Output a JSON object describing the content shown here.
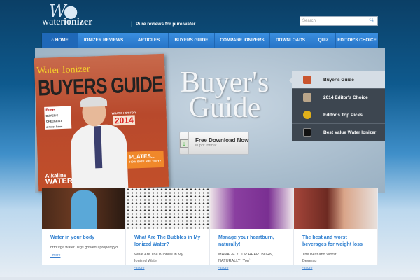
{
  "header": {
    "logo_mark": "W",
    "logo_text_light": "water",
    "logo_text_bold": "ionizer",
    "separator": "|",
    "tagline": "Pure reviews for pure water",
    "search_placeholder": "Search",
    "search_icon": "magnifier-icon"
  },
  "nav": [
    {
      "label": "HOME",
      "icon": "home-icon",
      "active": true
    },
    {
      "label": "IONIZER REVIEWS"
    },
    {
      "label": "ARTICLES"
    },
    {
      "label": "BUYERS GUIDE"
    },
    {
      "label": "COMPARE IONIZERS"
    },
    {
      "label": "DOWNLOADS"
    },
    {
      "label": "QUIZ"
    },
    {
      "label": "EDITOR'S CHOICE"
    }
  ],
  "hero": {
    "cover": {
      "title1": "Water Ionizer",
      "title2": "BUYERS GUIDE",
      "free": "Free",
      "checklist": "BUYER'S CHECKLIST",
      "must_have": "a must have",
      "hot": "WHAT'S HOT FOR",
      "year": "2014",
      "plates": "PLATES...",
      "plates_sub": "HOW SAFE ARE THEY?",
      "alkaline": "Alkaline",
      "water": "WATER"
    },
    "title_line1": "Buyer's",
    "title_line2": "Guide",
    "download_label": "Free Download Now",
    "download_sub": "in pdf  format",
    "menu": [
      {
        "label": "Buyer's Guide",
        "active": true,
        "color": "#c9542e"
      },
      {
        "label": "2014 Editor's Choice",
        "color": "#b9a58a"
      },
      {
        "label": "Editor's Top Picks",
        "color": "#e0b01a"
      },
      {
        "label": "Best Value Water Ionizer",
        "color": "#1d1d1d"
      }
    ]
  },
  "cards": [
    {
      "title": "Water in your body",
      "excerpt": [
        "http://ga.water.usgs.gov/edu/propertyyo"
      ],
      "more": "- more"
    },
    {
      "title": "What Are The Bubbles in My Ionized Water?",
      "excerpt": [
        "What Are The Bubbles in My",
        "Ionized Wate"
      ],
      "more": "- more"
    },
    {
      "title": "Manage your heartburn, naturally!",
      "excerpt": [
        "MANAGE YOUR HEARTBURN,",
        "NATURALLY! You`"
      ],
      "more": "- more"
    },
    {
      "title": "The best and worst beverages for weight loss",
      "excerpt": [
        "    The Best and Worst",
        "Beverag"
      ],
      "more": "- more"
    }
  ]
}
